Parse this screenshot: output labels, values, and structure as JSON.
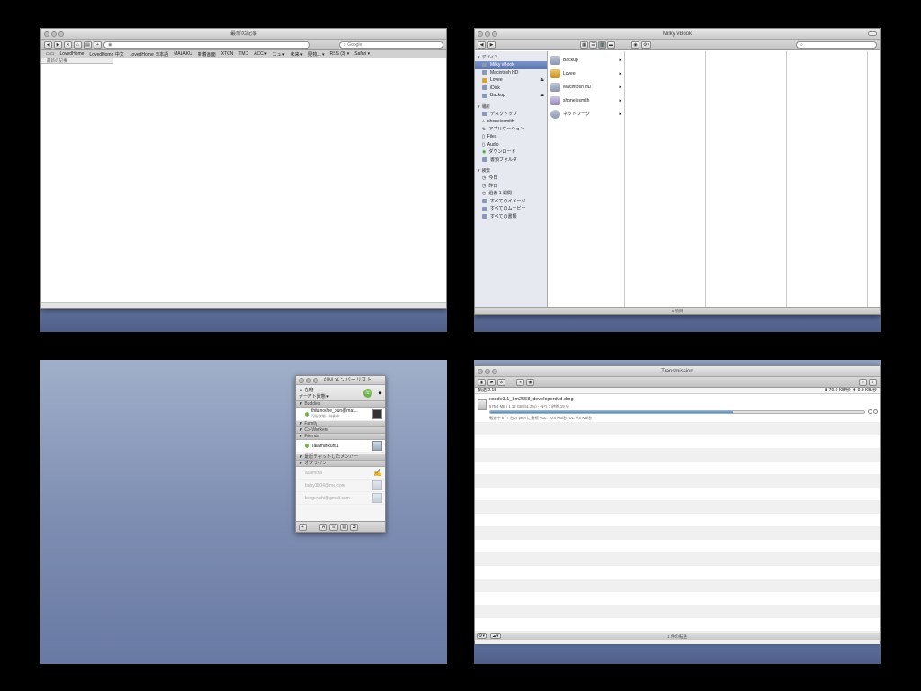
{
  "browser": {
    "title": "最新の記事",
    "search_placeholder": "Google",
    "bookmarks": [
      "LovedHome",
      "LovedHome 中文",
      "LovedHome 日本語",
      "MALAKU",
      "新着画面",
      "XTCN",
      "TMC",
      "ACC ▾",
      "ニュ ▾",
      "未来 ▾",
      "見物... ▾",
      "RSS (3) ▾",
      "Safari ▾"
    ],
    "dropdown_item": "最新の記事"
  },
  "finder": {
    "title": "Milky vBook",
    "devices_header": "▼ デバイス",
    "devices": [
      "Milky vBook",
      "Macintosh HD",
      "Lovee",
      "iDisk",
      "Backup"
    ],
    "places_header": "▼ 場所",
    "places": [
      "デスクトップ",
      "shoneiesmith",
      "アプリケーション",
      "Files",
      "Audio",
      "ダウンロード",
      "書類フォルダ"
    ],
    "search_header": "▼ 検索",
    "searches": [
      "今日",
      "昨日",
      "過去 1 週間",
      "すべてのイメージ",
      "すべてのムービー",
      "すべての書類"
    ],
    "columns": [
      "Backup",
      "Lovee",
      "Macintosh HD",
      "shoneiesmith",
      "ネットワーク"
    ],
    "status": "5 項目"
  },
  "aim": {
    "title": "AIM メンバーリスト",
    "status_line1": "☺ 在席",
    "status_line2": "ヤーアト状態 ▾",
    "groups": {
      "buddies": "▼ Buddies",
      "family": "▼ Family",
      "coworkers": "▼ Co-Workers",
      "friends": "▼ Friends",
      "recent": "▼ 最近チャットしたメンバー",
      "offline": "▼ オフライン"
    },
    "buddy_online": "thitunoche_pun@mat...",
    "buddy_online_status": "可能状態 · 待機中",
    "friend": "Taramarkunt1",
    "offline": [
      "afiamcfa",
      "baby1004@me.com",
      "bergenshi@gmail.com"
    ],
    "footer_buttons": [
      "+",
      "A",
      "☏",
      "▤",
      "⧉"
    ]
  },
  "transmission": {
    "title": "Transmission",
    "count": "転送 2.15",
    "speed_down": "⬇ 70.0 KB/秒",
    "speed_up": "⬆ 0.0 KB/秒",
    "torrent_name": "xcode3.1_8m2558_developerdvd.dmg",
    "torrent_info": "575.4 MB / 1.12 GB (51.2%) - 残り 1 時間 19 分",
    "torrent_peers": "転送中 8 / 7 台の peer に接続 - DL: 70.0 KB/秒, UL: 0.0 KB/秒",
    "progress": 0.65,
    "status": "1 件の転送"
  }
}
